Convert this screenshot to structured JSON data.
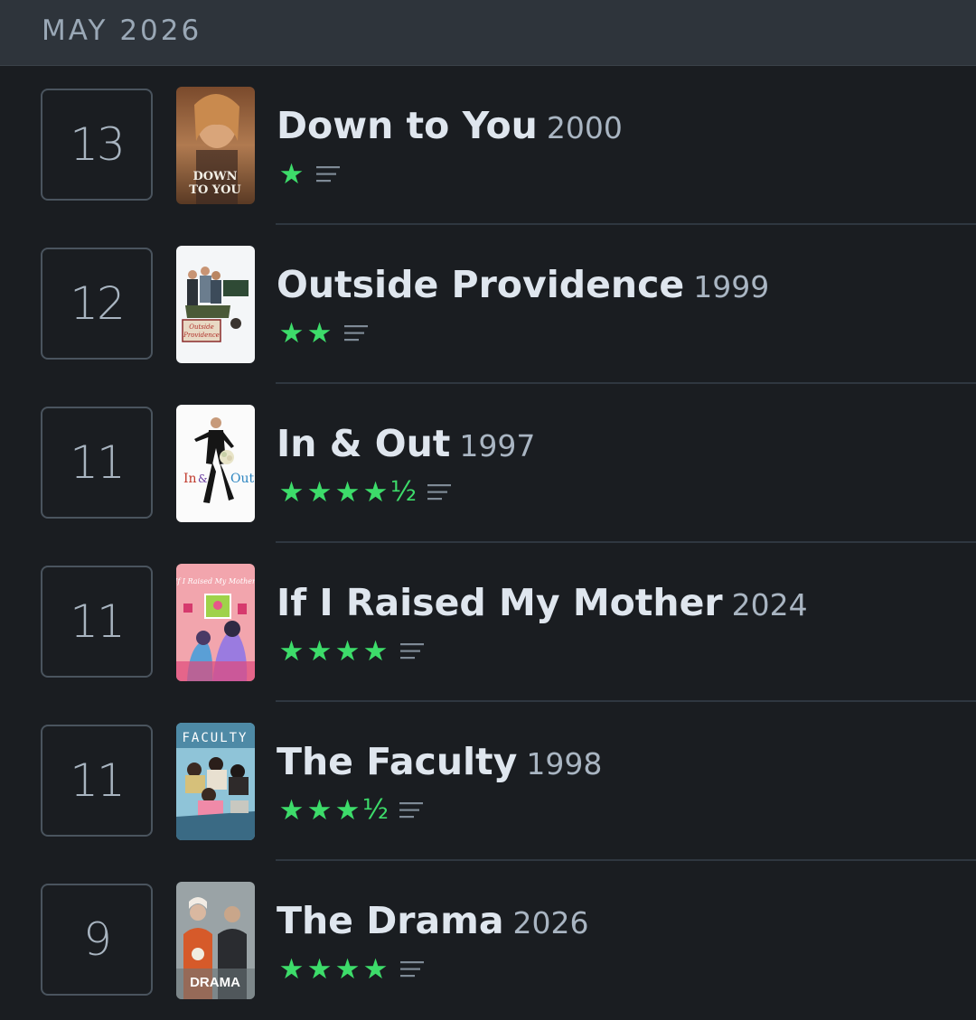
{
  "month": "MAY 2026",
  "entries": [
    {
      "day": "13",
      "title": "Down to You",
      "year": "2000",
      "rating": 1,
      "poster_text": "DOWN TO YOU"
    },
    {
      "day": "12",
      "title": "Outside Providence",
      "year": "1999",
      "rating": 2,
      "poster_text": "Outside Providence"
    },
    {
      "day": "11",
      "title": "In & Out",
      "year": "1997",
      "rating": 4.5,
      "poster_text": "In & Out"
    },
    {
      "day": "11",
      "title": "If I Raised My Mother",
      "year": "2024",
      "rating": 4,
      "poster_text": "If I Raised My Mother"
    },
    {
      "day": "11",
      "title": "The Faculty",
      "year": "1998",
      "rating": 3.5,
      "poster_text": "FACULTY"
    },
    {
      "day": "9",
      "title": "The Drama",
      "year": "2026",
      "rating": 4,
      "poster_text": "DRAMA"
    }
  ],
  "colors": {
    "background": "#1a1d21",
    "header": "#2e343b",
    "star": "#3ddc6a"
  },
  "icons": {
    "star": "star-icon",
    "half": "half-star-icon",
    "review": "review-lines-icon"
  }
}
